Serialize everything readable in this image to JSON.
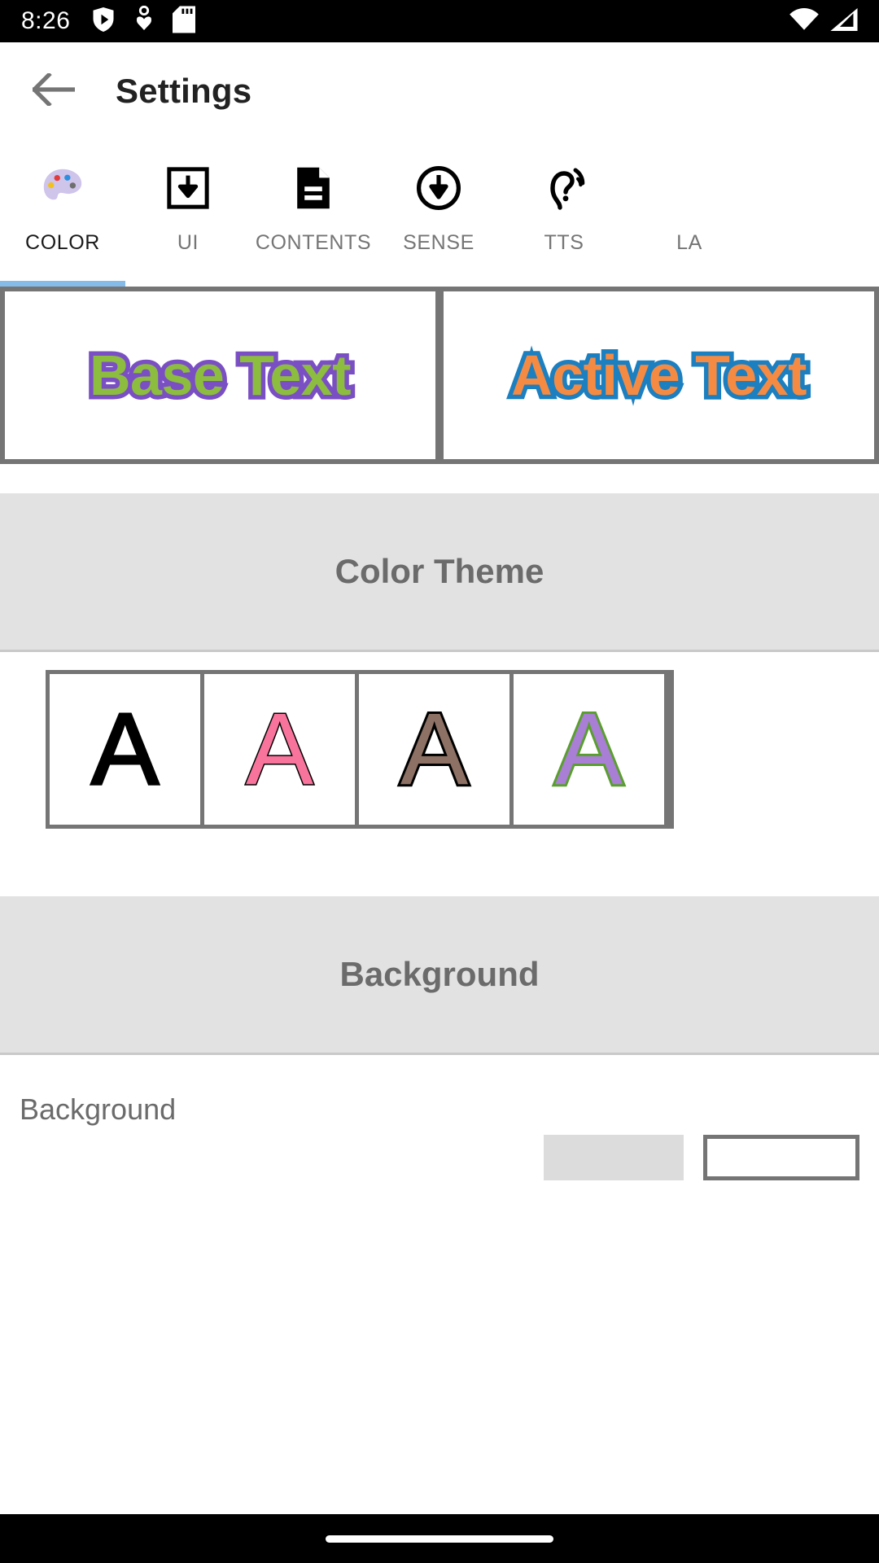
{
  "status_bar": {
    "time": "8:26",
    "left_icons": [
      "shield-play-icon",
      "heart-person-icon",
      "sd-card-icon"
    ],
    "right_icons": [
      "wifi-icon",
      "cellular-signal-icon"
    ]
  },
  "app_bar": {
    "back_icon": "arrow-left-icon",
    "title": "Settings"
  },
  "tabs": {
    "active_index": 0,
    "items": [
      {
        "label": "COLOR",
        "icon": "palette-icon"
      },
      {
        "label": "UI",
        "icon": "download-box-icon"
      },
      {
        "label": "CONTENTS",
        "icon": "document-icon"
      },
      {
        "label": "SENSE",
        "icon": "download-circle-icon"
      },
      {
        "label": "TTS",
        "icon": "hearing-icon"
      },
      {
        "label": "LA",
        "icon": "language-icon"
      }
    ]
  },
  "preview": {
    "base": {
      "text": "Base Text",
      "fill": "#8dbd3f",
      "outline": "#7b4fc4"
    },
    "active": {
      "text": "Active Text",
      "fill": "#f58b43",
      "outline": "#1c7fc0"
    }
  },
  "color_theme": {
    "header": "Color Theme",
    "swatches": [
      {
        "letter": "A",
        "fill": "#000000",
        "outline": "#000000"
      },
      {
        "letter": "A",
        "fill": "#f8749c",
        "outline": "#000000"
      },
      {
        "letter": "A",
        "fill": "#8d7164",
        "outline": "#000000"
      },
      {
        "letter": "A",
        "fill": "#a87fd4",
        "outline": "#5a9e2f"
      }
    ]
  },
  "background": {
    "header": "Background",
    "row_label": "Background"
  },
  "nav_bar": {
    "pill": "home-indicator"
  }
}
